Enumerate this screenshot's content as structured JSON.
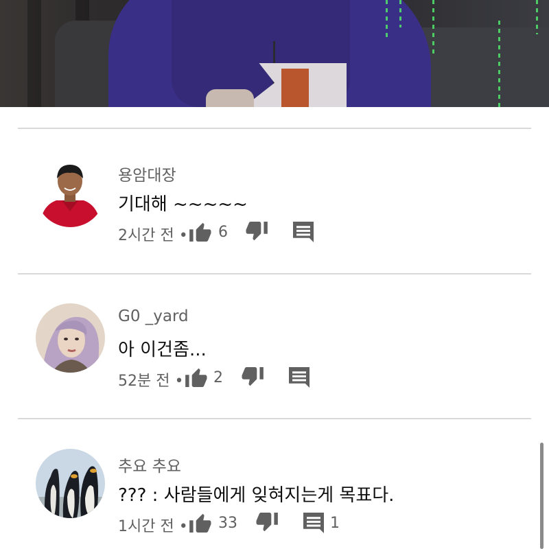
{
  "video": {
    "icon": "video-frame"
  },
  "comments": [
    {
      "author": "용암대장",
      "text": "기대해 ~~~~~",
      "time": "2시간 전",
      "likes": "6",
      "replies": ""
    },
    {
      "author": "G0 _yard",
      "text": "아 이건좀...",
      "time": "52분 전",
      "likes": "2",
      "replies": ""
    },
    {
      "author": "추요 추요",
      "text": "??? : 사람들에게 잊혀지는게 목표다.",
      "time": "1시간 전",
      "likes": "33",
      "replies": "1"
    }
  ],
  "meta": {
    "separator": "•"
  },
  "icons": {
    "like": "thumbs-up-icon",
    "dislike": "thumbs-down-icon",
    "reply": "comment-icon"
  },
  "colors": {
    "text": "#0f0f0f",
    "secondary": "#606060",
    "divider": "#d9d9d9"
  }
}
